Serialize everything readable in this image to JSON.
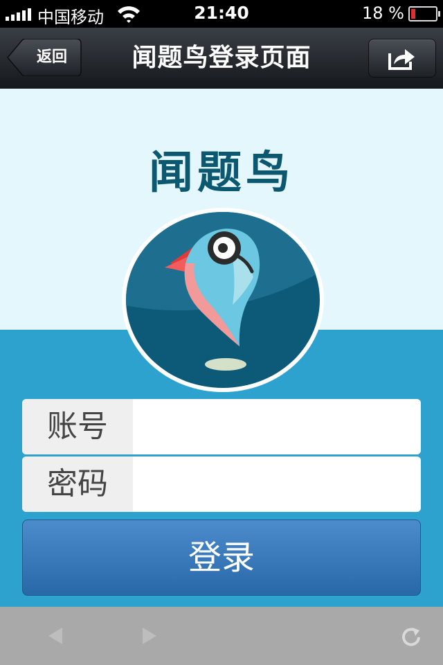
{
  "status_bar": {
    "carrier": "中国移动",
    "time": "21:40",
    "battery_percent": "18 %",
    "battery_level": 0.18
  },
  "nav": {
    "back_label": "返回",
    "title": "闻题鸟登录页面"
  },
  "app": {
    "name": "闻题鸟"
  },
  "form": {
    "account_label": "账号",
    "account_value": "",
    "password_label": "密码",
    "password_value": "",
    "login_label": "登录"
  },
  "icons": {
    "share": "share-icon",
    "back": "back-arrow-icon",
    "forward": "forward-arrow-icon",
    "refresh": "refresh-icon",
    "wifi": "wifi-icon",
    "logo": "bird-logo-icon"
  },
  "colors": {
    "nav_bg": "#1e2227",
    "page_light": "#e4f7fc",
    "page_blue": "#2ea2cf",
    "title_color": "#0b5870",
    "button_blue": "#3576b8"
  }
}
